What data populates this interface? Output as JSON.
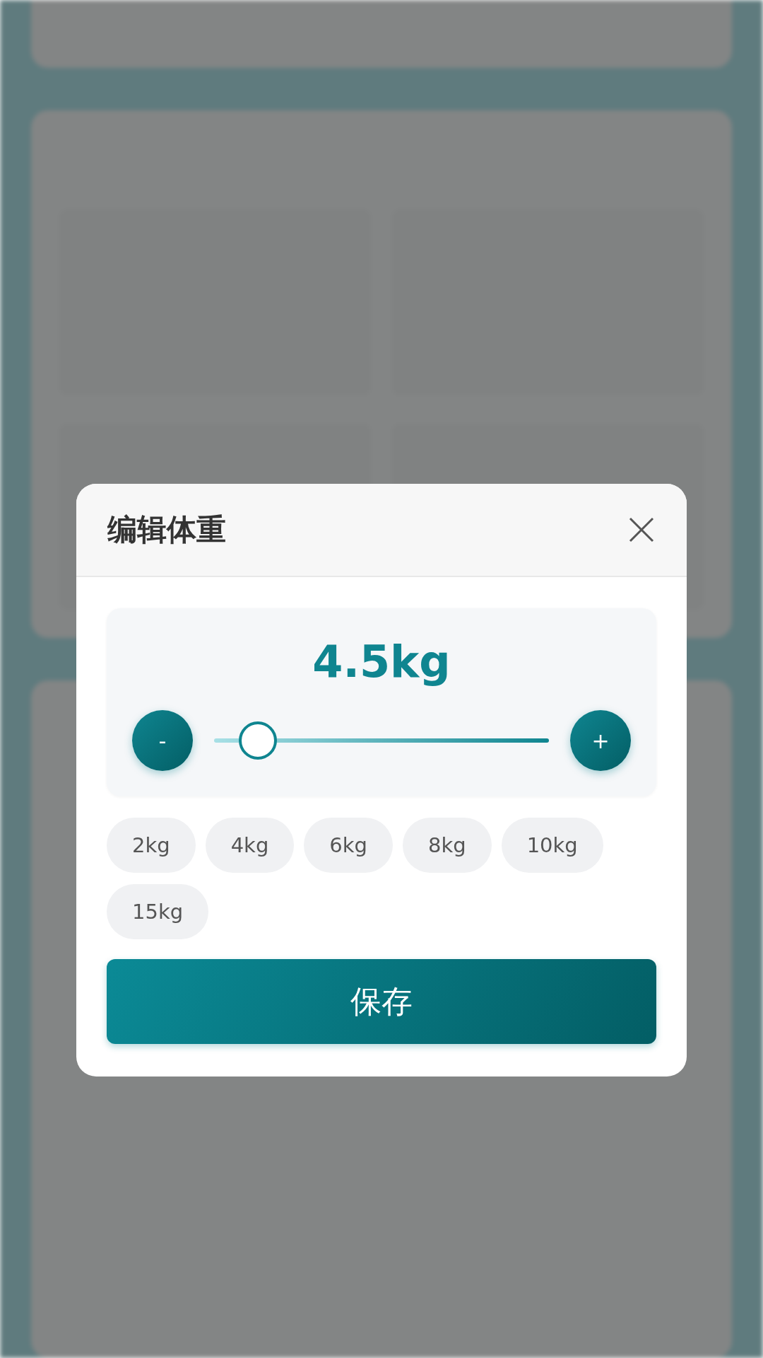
{
  "dialog": {
    "title": "编辑体重",
    "value": "4.5kg",
    "slider": {
      "level": 0.13,
      "decrease": "-",
      "increase": "+"
    },
    "presets": [
      {
        "label": "2kg",
        "selected": false
      },
      {
        "label": "4kg",
        "selected": false
      },
      {
        "label": "6kg",
        "selected": false
      },
      {
        "label": "8kg",
        "selected": false
      },
      {
        "label": "10kg",
        "selected": false
      },
      {
        "label": "15kg",
        "selected": false
      }
    ],
    "save": "保存"
  }
}
